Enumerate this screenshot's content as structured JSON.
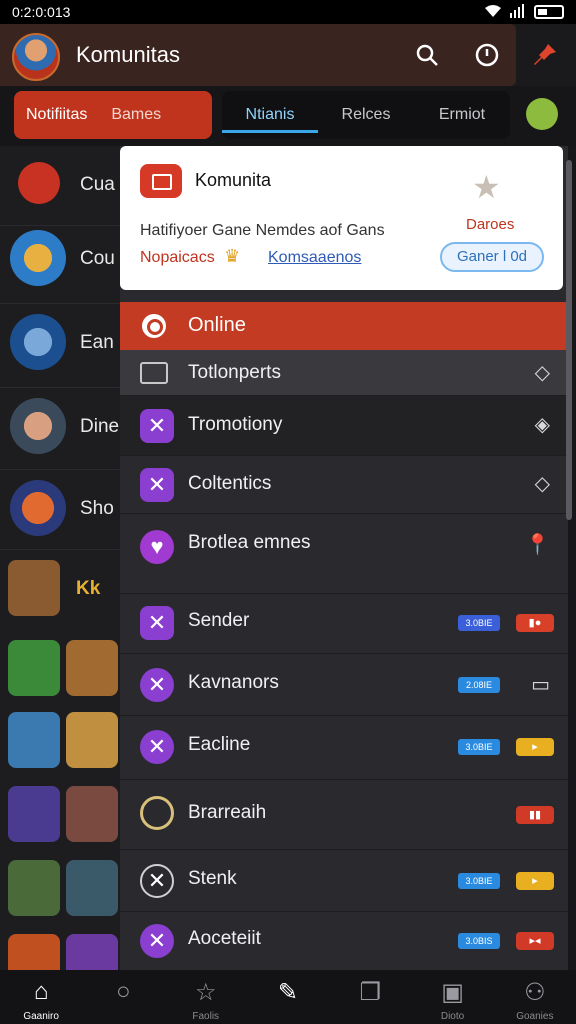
{
  "status_bar": {
    "time": "0:2:0:013"
  },
  "app": {
    "title": "Komunitas"
  },
  "tabs": {
    "group_primary": [
      {
        "label": "Notifiitas",
        "active": true
      },
      {
        "label": "Bames",
        "active": false
      }
    ],
    "group_secondary": [
      {
        "label": "Ntianis",
        "active": true
      },
      {
        "label": "Relces",
        "active": false
      },
      {
        "label": "Ermiot",
        "active": false
      }
    ]
  },
  "left_list": [
    {
      "label": "Cua"
    },
    {
      "label": "Cou"
    },
    {
      "label": "Ean"
    },
    {
      "label": "Dine"
    },
    {
      "label": "Sho"
    },
    {
      "label": "Kk"
    }
  ],
  "card": {
    "title": "Komunita",
    "side_label": "Daroes",
    "description": "Hatifiyoer Gane Nemdes aof Gans",
    "label_red": "Nopaicacs",
    "link": "Komsaaenos",
    "pill": "Ganer l 0d"
  },
  "online": {
    "label": "Online"
  },
  "menu": [
    {
      "label": "Totlonperts"
    },
    {
      "label": "Tromotiony"
    },
    {
      "label": "Coltentics"
    },
    {
      "label": "Brotlea emnes"
    },
    {
      "label": "Sender",
      "badge": "3.0BIE"
    },
    {
      "label": "Kavnanors",
      "badge": "2.08IE"
    },
    {
      "label": "Eacline",
      "badge": "3.0BIE"
    },
    {
      "label": "Brarreaih"
    },
    {
      "label": "Stenk",
      "badge": "3.0BIE"
    },
    {
      "label": "Aoceteiit",
      "badge": "3.0BIS"
    }
  ],
  "bottom_nav": [
    {
      "label": "Gaaniro",
      "icon": "home-icon",
      "active": true
    },
    {
      "label": "",
      "icon": "search-icon",
      "active": false
    },
    {
      "label": "Faolis",
      "icon": "star-icon",
      "active": false
    },
    {
      "label": "",
      "icon": "feather-icon",
      "active": false
    },
    {
      "label": "",
      "icon": "windows-icon",
      "active": false
    },
    {
      "label": "Dioto",
      "icon": "image-icon",
      "active": false
    },
    {
      "label": "Goanies",
      "icon": "profile-icon",
      "active": false
    }
  ],
  "colors": {
    "accent_red": "#c23b22",
    "accent_blue": "#3aa7e8",
    "purple": "#8a3fd0"
  }
}
